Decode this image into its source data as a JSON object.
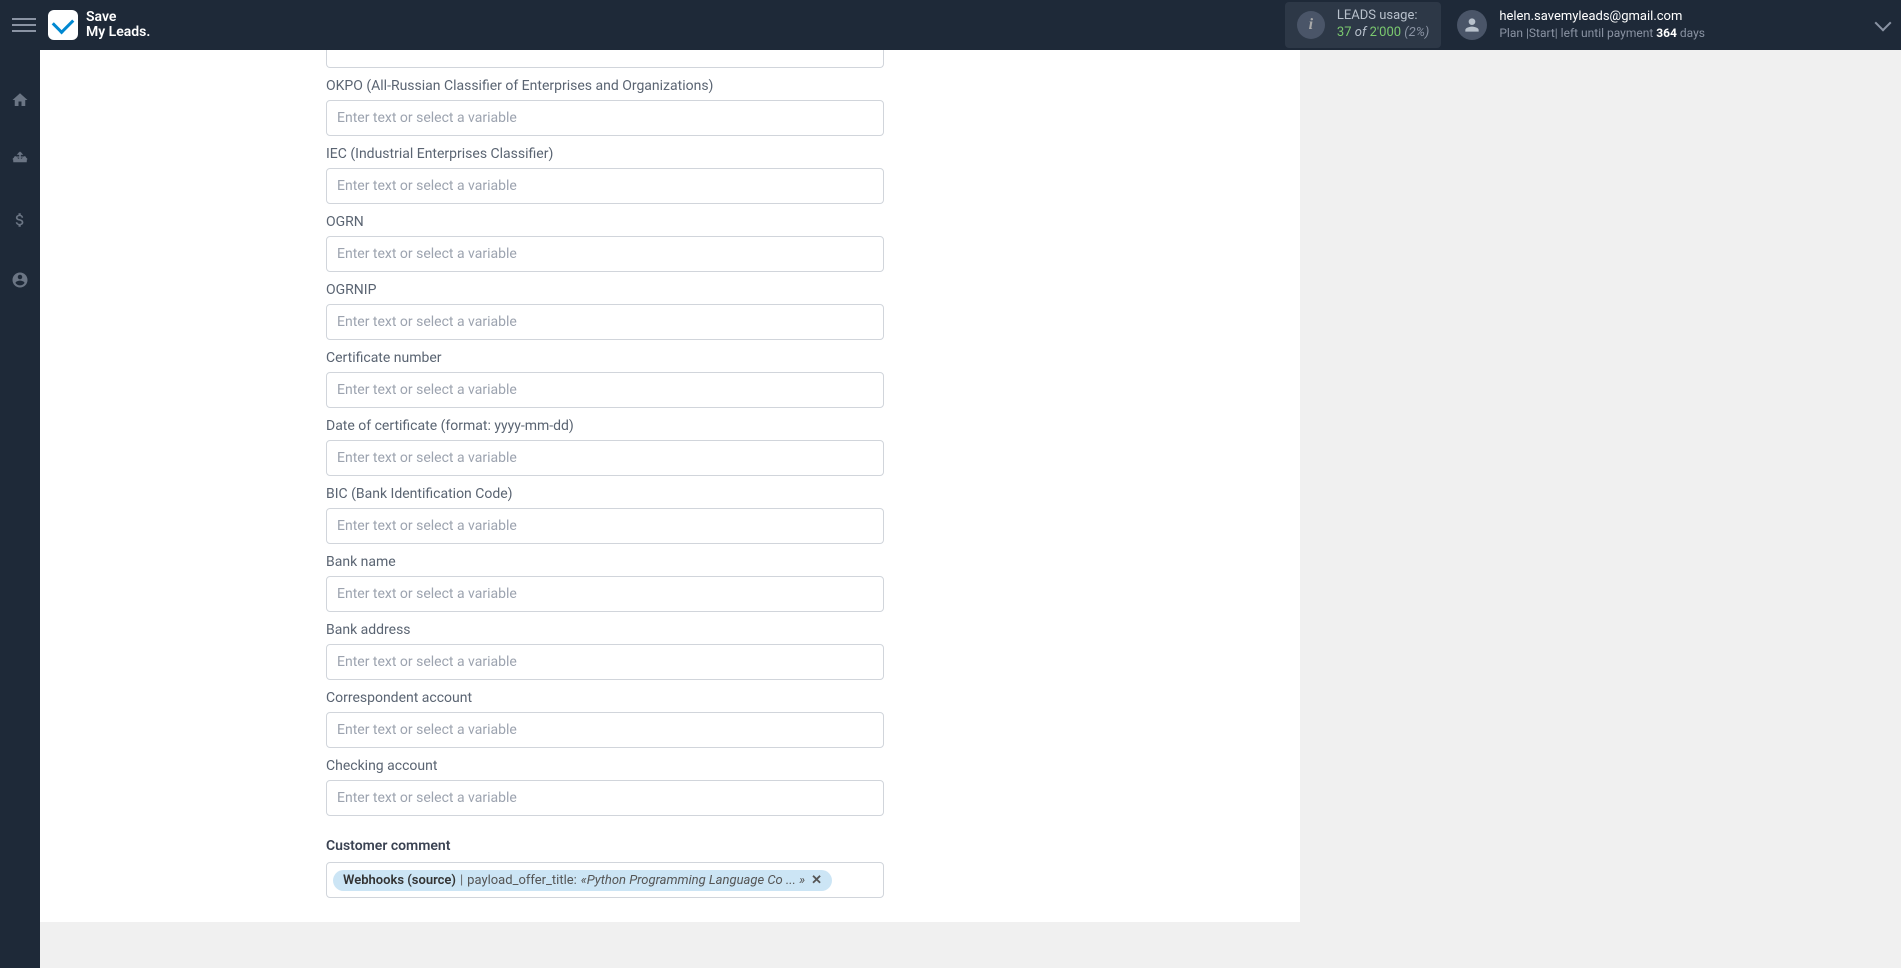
{
  "brand": {
    "line1": "Save",
    "line2": "My Leads."
  },
  "header": {
    "leads_usage_label": "LEADS usage:",
    "leads_used": "37",
    "leads_of": "of",
    "leads_total": "2'000",
    "leads_pct": "(2%)"
  },
  "user": {
    "email": "helen.savemyleads@gmail.com",
    "plan_prefix": "Plan |",
    "plan_name": "Start",
    "plan_mid": "| left until payment ",
    "plan_days": "364",
    "plan_suffix": " days"
  },
  "form": {
    "placeholder": "Enter text or select a variable",
    "fields": [
      {
        "label": "OKPO (All-Russian Classifier of Enterprises and Organizations)"
      },
      {
        "label": "IEC (Industrial Enterprises Classifier)"
      },
      {
        "label": "OGRN"
      },
      {
        "label": "OGRNIP"
      },
      {
        "label": "Certificate number"
      },
      {
        "label": "Date of certificate (format: yyyy-mm-dd)"
      },
      {
        "label": "BIC (Bank Identification Code)"
      },
      {
        "label": "Bank name"
      },
      {
        "label": "Bank address"
      },
      {
        "label": "Correspondent account"
      },
      {
        "label": "Checking account"
      }
    ],
    "comment_label": "Customer comment",
    "tag": {
      "source": "Webhooks (source)",
      "pipe": " | ",
      "payload": "payload_offer_title: ",
      "value": "«Python Programming Language Co ... »"
    }
  }
}
